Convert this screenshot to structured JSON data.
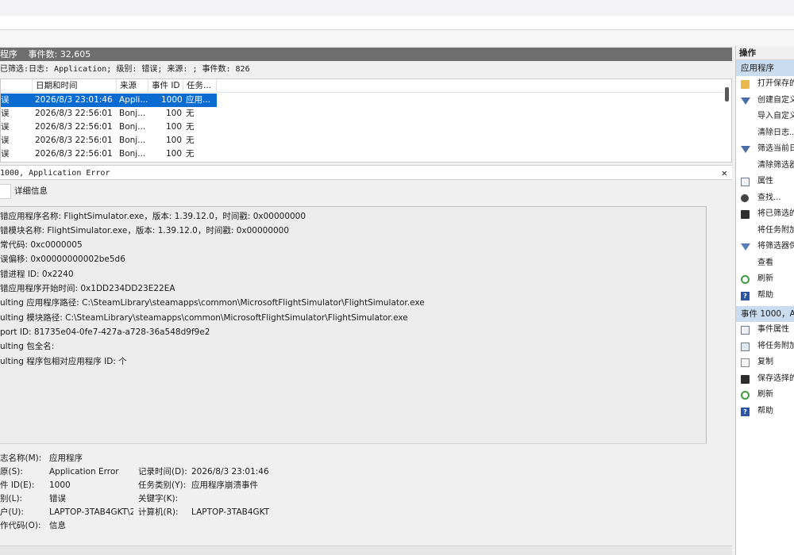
{
  "log_bar": {
    "name": "程序",
    "event_count": "事件数: 32,605"
  },
  "filter_line": "已筛选:日志: Application; 级别: 错误; 来源: ; 事件数: 826",
  "grid": {
    "headers": [
      "日期和时间",
      "来源",
      "事件 ID",
      "任务..."
    ],
    "rows": [
      {
        "level": "误",
        "datetime": "2026/8/3 23:01:46",
        "source": "Appli...",
        "event_id": "1000",
        "task": "应用...",
        "selected": true
      },
      {
        "level": "误",
        "datetime": "2026/8/3 22:56:01",
        "source": "Bonj...",
        "event_id": "100",
        "task": "无",
        "selected": false
      },
      {
        "level": "误",
        "datetime": "2026/8/3 22:56:01",
        "source": "Bonj...",
        "event_id": "100",
        "task": "无",
        "selected": false
      },
      {
        "level": "误",
        "datetime": "2026/8/3 22:56:01",
        "source": "Bonj...",
        "event_id": "100",
        "task": "无",
        "selected": false
      },
      {
        "level": "误",
        "datetime": "2026/8/3 22:56:01",
        "source": "Bonj...",
        "event_id": "100",
        "task": "无",
        "selected": false
      }
    ]
  },
  "event_header": "1000, Application Error",
  "tabs": {
    "general": "",
    "details": "详细信息"
  },
  "description_lines": [
    "错应用程序名称: FlightSimulator.exe，版本: 1.39.12.0，时间戳: 0x00000000",
    "错模块名称: FlightSimulator.exe，版本: 1.39.12.0，时间戳: 0x00000000",
    "常代码: 0xc0000005",
    "误偏移: 0x00000000002be5d6",
    "错进程 ID: 0x2240",
    "错应用程序开始时间: 0x1DD234DD23E22EA",
    "ulting 应用程序路径: C:\\SteamLibrary\\steamapps\\common\\MicrosoftFlightSimulator\\FlightSimulator.exe",
    "ulting 模块路径: C:\\SteamLibrary\\steamapps\\common\\MicrosoftFlightSimulator\\FlightSimulator.exe",
    "port ID: 81735e04-0fe7-427a-a728-36a548d9f9e2",
    "ulting 包全名:",
    "ulting 程序包相对应用程序 ID: 个"
  ],
  "props": {
    "log_name": {
      "label": "志名称(M):",
      "value": "应用程序"
    },
    "source": {
      "label": "原(S):",
      "value": "Application Error"
    },
    "logged": {
      "label": "记录时间(D):",
      "value": "2026/8/3 23:01:46"
    },
    "event_id": {
      "label": "件 ID(E):",
      "value": "1000"
    },
    "task": {
      "label": "任务类别(Y):",
      "value": "应用程序崩溃事件"
    },
    "level": {
      "label": "别(L):",
      "value": "错误"
    },
    "keywords": {
      "label": "关键字(K):",
      "value": ""
    },
    "user": {
      "label": "户(U):",
      "value": "LAPTOP-3TAB4GKT\\2("
    },
    "computer": {
      "label": "计算机(R):",
      "value": "LAPTOP-3TAB4GKT"
    },
    "opcode": {
      "label": "作代码(O):",
      "value": "信息"
    }
  },
  "actions": {
    "title": "操作",
    "section1": "应用程序",
    "items1": [
      {
        "icon": "folder-icon",
        "label": "打开保存的"
      },
      {
        "icon": "filter-icon",
        "label": "创建自定义"
      },
      {
        "icon": "none",
        "label": "导入自定义"
      },
      {
        "icon": "none",
        "label": "清除日志..."
      },
      {
        "icon": "filter-icon",
        "label": "筛选当前日"
      },
      {
        "icon": "none",
        "label": "清除筛选器"
      },
      {
        "icon": "properties-icon",
        "label": "属性"
      },
      {
        "icon": "find-icon",
        "label": "查找..."
      },
      {
        "icon": "save-icon",
        "label": "将已筛选的"
      },
      {
        "icon": "none",
        "label": "将任务附加"
      },
      {
        "icon": "filter-icon",
        "label": "将筛选器保"
      },
      {
        "icon": "none",
        "label": "查看"
      },
      {
        "icon": "refresh-icon",
        "label": "刷新"
      },
      {
        "icon": "help-icon",
        "label": "帮助"
      }
    ],
    "section2": "事件 1000，Ap",
    "items2": [
      {
        "icon": "properties-icon",
        "label": "事件属性"
      },
      {
        "icon": "attach-icon",
        "label": "将任务附加"
      },
      {
        "icon": "copy-icon",
        "label": "复制"
      },
      {
        "icon": "save-icon",
        "label": "保存选择的"
      },
      {
        "icon": "refresh-icon",
        "label": "刷新"
      },
      {
        "icon": "help-icon",
        "label": "帮助"
      }
    ]
  }
}
